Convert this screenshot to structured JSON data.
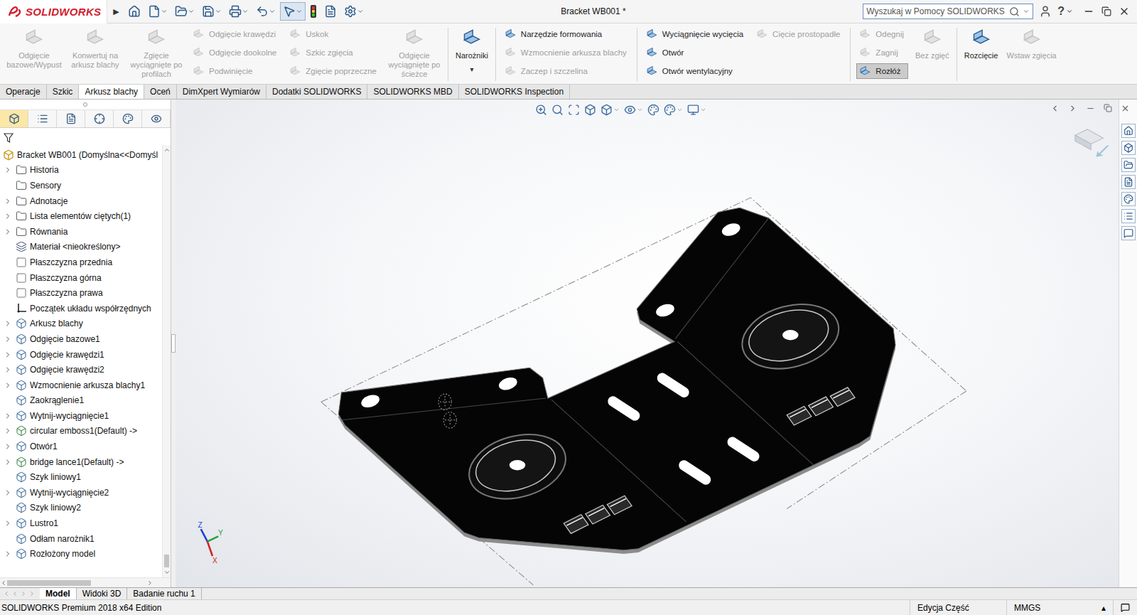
{
  "app": {
    "logo": "SOLIDWORKS",
    "menu_arrow": "▶"
  },
  "window": {
    "title": "Bracket WB001 *"
  },
  "search": {
    "placeholder": "Wyszukaj w Pomocy SOLIDWORKS"
  },
  "help": "?",
  "ribbon": {
    "groups": [
      {
        "columns": [
          {
            "kind": "large",
            "items": [
              {
                "label": "Odgięcie bazowe/Wypust",
                "disabled": true,
                "pressed": false
              }
            ]
          },
          {
            "kind": "large",
            "items": [
              {
                "label": "Konwertuj na arkusz blachy",
                "disabled": true,
                "pressed": false
              }
            ]
          },
          {
            "kind": "large",
            "items": [
              {
                "label": "Zgięcie wyciągnięte po profilach",
                "disabled": true,
                "pressed": false
              }
            ]
          },
          {
            "kind": "stack",
            "items": [
              {
                "label": "Odgięcie krawędzi",
                "disabled": true,
                "pressed": false
              },
              {
                "label": "Odgięcie dookolne",
                "disabled": true,
                "pressed": false
              },
              {
                "label": "Podwinięcie",
                "disabled": true,
                "pressed": false
              }
            ]
          },
          {
            "kind": "stack",
            "items": [
              {
                "label": "Uskok",
                "disabled": true,
                "pressed": false
              },
              {
                "label": "Szkic zgięcia",
                "disabled": true,
                "pressed": false
              },
              {
                "label": "Zgięcie poprzeczne",
                "disabled": true,
                "pressed": false
              }
            ]
          },
          {
            "kind": "large",
            "items": [
              {
                "label": "Odgięcie wyciągnięte po ścieżce",
                "disabled": true,
                "pressed": false
              }
            ]
          }
        ]
      },
      {
        "columns": [
          {
            "kind": "large",
            "items": [
              {
                "label": "Narożniki",
                "disabled": false,
                "pressed": false,
                "dropdown": "▾"
              }
            ]
          }
        ]
      },
      {
        "columns": [
          {
            "kind": "stack",
            "items": [
              {
                "label": "Narzędzie formowania",
                "disabled": false,
                "pressed": false
              },
              {
                "label": "Wzmocnienie arkusza blachy",
                "disabled": true,
                "pressed": false
              },
              {
                "label": "Zaczep i szczelina",
                "disabled": true,
                "pressed": false
              }
            ]
          }
        ]
      },
      {
        "columns": [
          {
            "kind": "stack",
            "items": [
              {
                "label": "Wyciągnięcie wycięcia",
                "disabled": false,
                "pressed": false
              },
              {
                "label": "Otwór",
                "disabled": false,
                "pressed": false
              },
              {
                "label": "Otwór wentylacyjny",
                "disabled": false,
                "pressed": false
              }
            ]
          },
          {
            "kind": "stack",
            "items": [
              {
                "label": "Cięcie prostopadłe",
                "disabled": true,
                "pressed": false
              }
            ]
          }
        ]
      },
      {
        "columns": [
          {
            "kind": "stack",
            "items": [
              {
                "label": "Odegnij",
                "disabled": true,
                "pressed": false
              },
              {
                "label": "Zagnij",
                "disabled": true,
                "pressed": false
              },
              {
                "label": "Rozłóż",
                "disabled": false,
                "pressed": true
              }
            ]
          },
          {
            "kind": "large",
            "items": [
              {
                "label": "Bez zgięć",
                "disabled": true,
                "pressed": false
              }
            ]
          }
        ]
      },
      {
        "columns": [
          {
            "kind": "large",
            "items": [
              {
                "label": "Rozcięcie",
                "disabled": false,
                "pressed": false
              }
            ]
          },
          {
            "kind": "large",
            "items": [
              {
                "label": "Wstaw zgięcia",
                "disabled": true,
                "pressed": false
              }
            ]
          }
        ]
      }
    ]
  },
  "tabs": [
    {
      "label": "Operacje",
      "selected": false
    },
    {
      "label": "Szkic",
      "selected": false
    },
    {
      "label": "Arkusz blachy",
      "selected": true
    },
    {
      "label": "Oceń",
      "selected": false
    },
    {
      "label": "DimXpert Wymiarów",
      "selected": false
    },
    {
      "label": "Dodatki SOLIDWORKS",
      "selected": false
    },
    {
      "label": "SOLIDWORKS MBD",
      "selected": false
    },
    {
      "label": "SOLIDWORKS Inspection",
      "selected": false
    }
  ],
  "panel_tabs": [
    {
      "selected": true
    },
    {
      "selected": false
    },
    {
      "selected": false
    },
    {
      "selected": false
    },
    {
      "selected": false
    },
    {
      "selected": false
    }
  ],
  "tree": {
    "root": "Bracket WB001  (Domyślna<<Domyśl",
    "scroll": {
      "position": 1
    },
    "hscroll": {
      "position": 0
    },
    "items": [
      {
        "label": "Historia",
        "expandable": true,
        "kind": "folder"
      },
      {
        "label": "Sensory",
        "expandable": false,
        "kind": "folder"
      },
      {
        "label": "Adnotacje",
        "expandable": true,
        "kind": "folder"
      },
      {
        "label": "Lista elementów ciętych(1)",
        "expandable": true,
        "kind": "folder"
      },
      {
        "label": "Równania",
        "expandable": true,
        "kind": "folder"
      },
      {
        "label": "Materiał <nieokreślony>",
        "expandable": false,
        "kind": "material"
      },
      {
        "label": "Płaszczyzna przednia",
        "expandable": false,
        "kind": "plane"
      },
      {
        "label": "Płaszczyzna górna",
        "expandable": false,
        "kind": "plane"
      },
      {
        "label": "Płaszczyzna prawa",
        "expandable": false,
        "kind": "plane"
      },
      {
        "label": "Początek układu współrzędnych",
        "expandable": false,
        "kind": "origin"
      },
      {
        "label": "Arkusz blachy",
        "expandable": true,
        "kind": "feature"
      },
      {
        "label": "Odgięcie bazowe1",
        "expandable": true,
        "kind": "feature"
      },
      {
        "label": "Odgięcie krawędzi1",
        "expandable": true,
        "kind": "feature"
      },
      {
        "label": "Odgięcie krawędzi2",
        "expandable": true,
        "kind": "feature"
      },
      {
        "label": "Wzmocnienie arkusza blachy1",
        "expandable": true,
        "kind": "feature"
      },
      {
        "label": "Zaokrąglenie1",
        "expandable": false,
        "kind": "feature"
      },
      {
        "label": "Wytnij-wyciągnięcie1",
        "expandable": true,
        "kind": "feature"
      },
      {
        "label": "circular emboss1(Default) ->",
        "expandable": true,
        "kind": "library"
      },
      {
        "label": "Otwór1",
        "expandable": true,
        "kind": "feature"
      },
      {
        "label": "bridge lance1(Default) ->",
        "expandable": true,
        "kind": "library"
      },
      {
        "label": "Szyk liniowy1",
        "expandable": false,
        "kind": "feature"
      },
      {
        "label": "Wytnij-wyciągnięcie2",
        "expandable": true,
        "kind": "feature"
      },
      {
        "label": "Szyk liniowy2",
        "expandable": false,
        "kind": "feature"
      },
      {
        "label": "Lustro1",
        "expandable": true,
        "kind": "feature"
      },
      {
        "label": "Odłam narożnik1",
        "expandable": false,
        "kind": "feature"
      },
      {
        "label": "Rozłożony model",
        "expandable": true,
        "kind": "feature"
      }
    ]
  },
  "viewport": {
    "triad": {
      "z": "Z",
      "y": "Y",
      "x": "X"
    }
  },
  "bottom_tabs": [
    {
      "label": "Model",
      "selected": true
    },
    {
      "label": "Widoki 3D",
      "selected": false
    },
    {
      "label": "Badanie ruchu 1",
      "selected": false
    }
  ],
  "status_bar": {
    "product": "SOLIDWORKS Premium 2018 x64 Edition",
    "mode": "Edycja Część",
    "units": "MMGS",
    "units_arrow": "▴"
  }
}
